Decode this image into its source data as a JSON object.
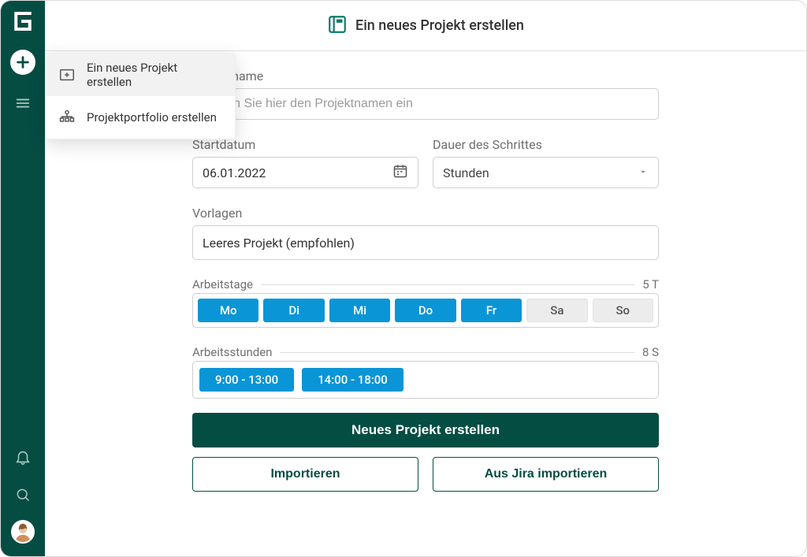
{
  "header": {
    "title": "Ein neues Projekt erstellen"
  },
  "flyout": {
    "items": [
      {
        "label": "Ein neues Projekt erstellen",
        "icon": "new-project-icon"
      },
      {
        "label": "Projektportfolio erstellen",
        "icon": "portfolio-icon"
      }
    ]
  },
  "form": {
    "projectname_label": "Projektname",
    "projectname_placeholder": "Geben Sie hier den Projektnamen ein",
    "projectname_value": "",
    "startdate_label": "Startdatum",
    "startdate_value": "06.01.2022",
    "stepduration_label": "Dauer des Schrittes",
    "stepduration_value": "Stunden",
    "templates_label": "Vorlagen",
    "templates_value": "Leeres Projekt (empfohlen)",
    "workdays_label": "Arbeitstage",
    "workdays_count": "5 T",
    "workhours_label": "Arbeitsstunden",
    "workhours_count": "8 S",
    "days": [
      {
        "label": "Mo",
        "active": true
      },
      {
        "label": "Di",
        "active": true
      },
      {
        "label": "Mi",
        "active": true
      },
      {
        "label": "Do",
        "active": true
      },
      {
        "label": "Fr",
        "active": true
      },
      {
        "label": "Sa",
        "active": false
      },
      {
        "label": "So",
        "active": false
      }
    ],
    "hours": [
      {
        "label": "9:00 - 13:00"
      },
      {
        "label": "14:00 - 18:00"
      }
    ],
    "buttons": {
      "create": "Neues Projekt erstellen",
      "import": "Importieren",
      "import_jira": "Aus Jira importieren"
    }
  }
}
